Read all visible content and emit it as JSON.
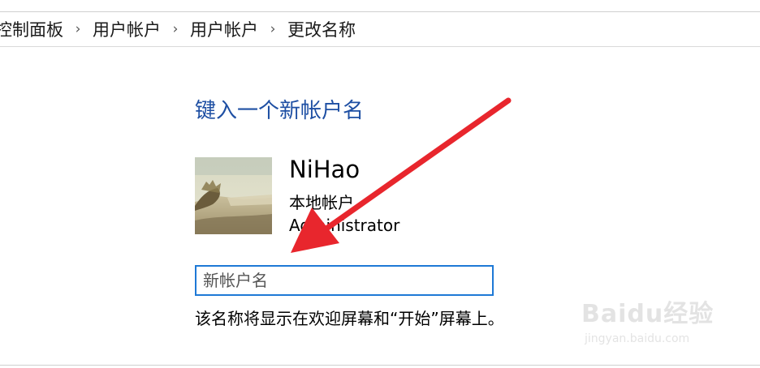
{
  "breadcrumb": {
    "items": [
      "控制面板",
      "用户帐户",
      "用户帐户",
      "更改名称"
    ],
    "separator": "›"
  },
  "page": {
    "title": "键入一个新帐户名"
  },
  "account": {
    "name": "NiHao",
    "type": "本地帐户",
    "role": "Administrator",
    "avatar_icon": "user-avatar-landscape-photo"
  },
  "new_name_input": {
    "value": "",
    "placeholder": "新帐户名"
  },
  "hint": "该名称将显示在欢迎屏幕和“开始”屏幕上。",
  "watermark": {
    "logo_text": "Baidu经验",
    "url": "jingyan.baidu.com"
  },
  "colors": {
    "title": "#1e4fa3",
    "input_border": "#1e79d6",
    "arrow": "#e8262d"
  }
}
